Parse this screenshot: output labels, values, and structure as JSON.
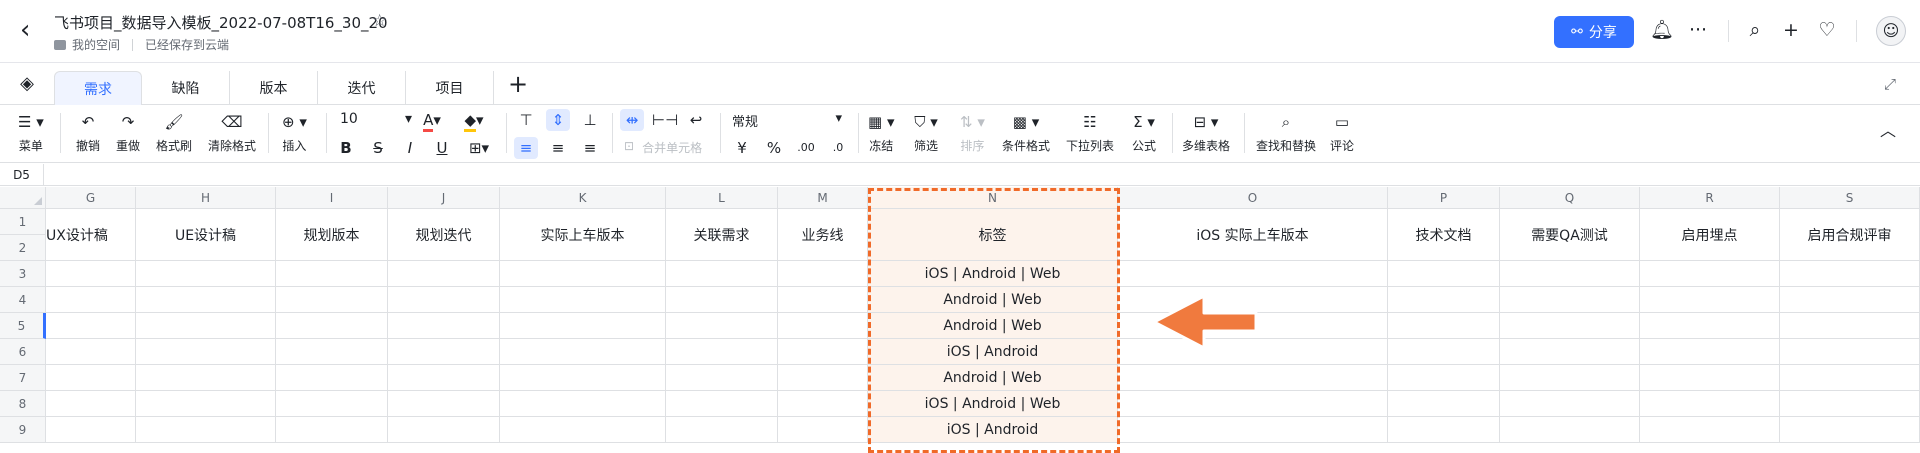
{
  "header": {
    "doc_title": "飞书项目_数据导入模板_2022-07-08T16_30_20",
    "breadcrumb_space": "我的空间",
    "save_status": "已经保存到云端",
    "share_label": "分享"
  },
  "tabs": [
    "需求",
    "缺陷",
    "版本",
    "迭代",
    "项目"
  ],
  "toolbar": {
    "menu": "菜单",
    "undo": "撤销",
    "redo": "重做",
    "format_painter": "格式刷",
    "clear_format": "清除格式",
    "insert": "插入",
    "font_size": "10",
    "merge_cells": "合并单元格",
    "number_format": "常规",
    "freeze": "冻结",
    "filter": "筛选",
    "sort": "排序",
    "conditional_format": "条件格式",
    "dropdown_list": "下拉列表",
    "formula": "公式",
    "multidim_table": "多维表格",
    "find_replace": "查找和替换",
    "comment": "评论",
    "currency": "¥",
    "percent": "%",
    "dec_more": ".00",
    "dec_less": ".0"
  },
  "cell_ref": "D5",
  "columns": [
    "G",
    "H",
    "I",
    "J",
    "K",
    "L",
    "M",
    "N",
    "O",
    "P",
    "Q",
    "R",
    "S"
  ],
  "headers": [
    "UX设计稿",
    "UE设计稿",
    "规划版本",
    "规划迭代",
    "实际上车版本",
    "关联需求",
    "业务线",
    "标签",
    "iOS 实际上车版本",
    "技术文档",
    "需要QA测试",
    "启用埋点",
    "启用合规评审"
  ],
  "rows": [
    "1",
    "2",
    "3",
    "4",
    "5",
    "6",
    "7",
    "8",
    "9"
  ],
  "tag_values": [
    "iOS | Android | Web",
    "Android | Web",
    "Android | Web",
    "iOS | Android",
    "Android | Web",
    "iOS | Android | Web",
    "iOS | Android"
  ],
  "colors": {
    "accent": "#3370ff",
    "highlight": "#f06a29",
    "arrow": "#f07a3e"
  }
}
